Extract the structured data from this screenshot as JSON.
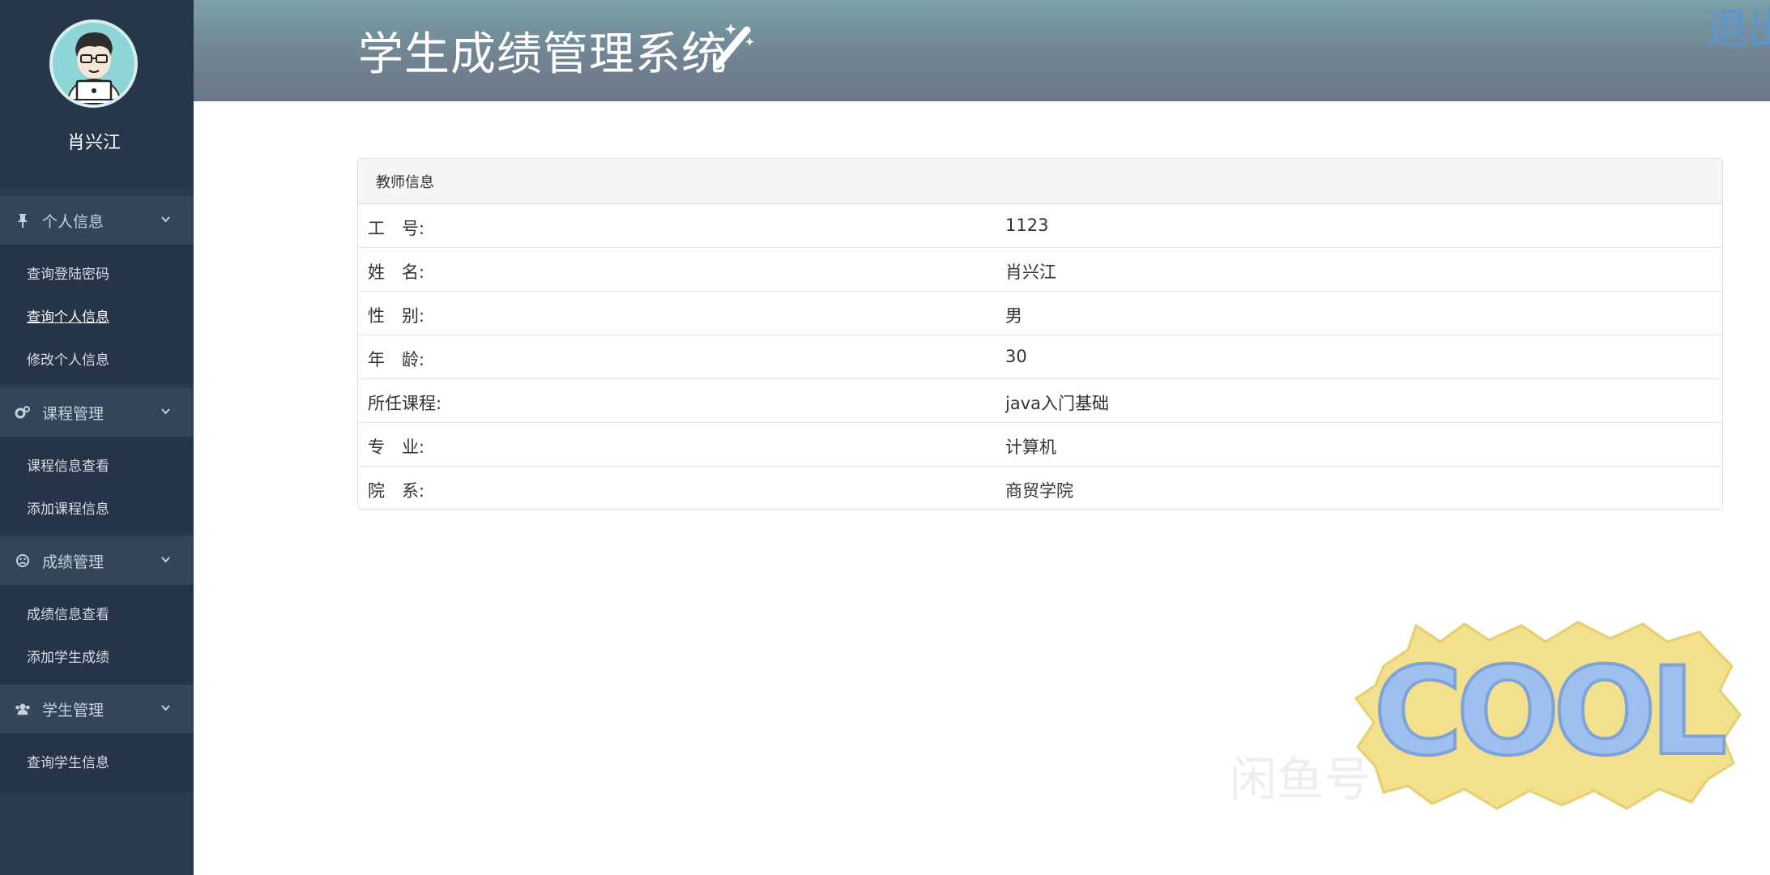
{
  "user": {
    "name": "肖兴江"
  },
  "header": {
    "title": "学生成绩管理系统",
    "logout_label": "退出"
  },
  "sidebar": {
    "groups": [
      {
        "label": "个人信息",
        "icon": "pin-icon",
        "items": [
          {
            "label": "查询登陆密码",
            "active": false
          },
          {
            "label": "查询个人信息",
            "active": true
          },
          {
            "label": "修改个人信息",
            "active": false
          }
        ]
      },
      {
        "label": "课程管理",
        "icon": "cogs-icon",
        "items": [
          {
            "label": "课程信息查看",
            "active": false
          },
          {
            "label": "添加课程信息",
            "active": false
          }
        ]
      },
      {
        "label": "成绩管理",
        "icon": "frown-icon",
        "items": [
          {
            "label": "成绩信息查看",
            "active": false
          },
          {
            "label": "添加学生成绩",
            "active": false
          }
        ]
      },
      {
        "label": "学生管理",
        "icon": "users-icon",
        "items": [
          {
            "label": "查询学生信息",
            "active": false
          }
        ]
      }
    ]
  },
  "panel": {
    "heading": "教师信息",
    "rows": [
      {
        "label": "工　号:",
        "value": "1123"
      },
      {
        "label": "姓　名:",
        "value": "肖兴江"
      },
      {
        "label": "性　别:",
        "value": "男"
      },
      {
        "label": "年　龄:",
        "value": "30"
      },
      {
        "label": "所任课程:",
        "value": "java入门基础"
      },
      {
        "label": "专　业:",
        "value": "计算机"
      },
      {
        "label": "院　系:",
        "value": "商贸学院"
      }
    ]
  },
  "sticker": {
    "text": "COOL"
  },
  "watermark": {
    "text": "闲鱼号"
  },
  "colors": {
    "sidebar": "#2b3a4e",
    "group_header": "#334559",
    "header_top": "#7aa0a9",
    "header_bottom": "#6c7788",
    "logout": "#5c95cf"
  }
}
